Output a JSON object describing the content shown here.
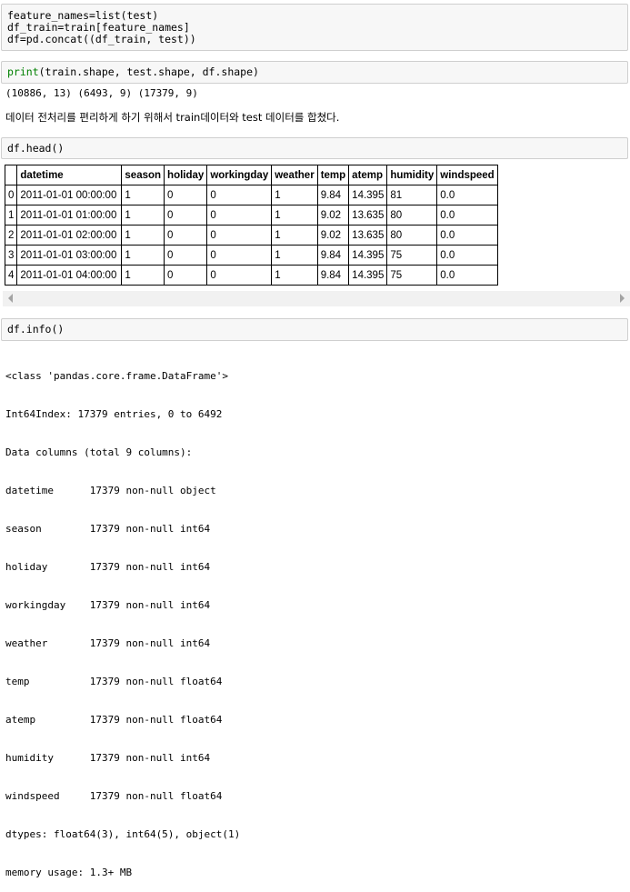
{
  "cells": {
    "c1": {
      "line1": "feature_names=list(test)",
      "line2": "df_train=train[feature_names]",
      "line3": "df=pd.concat((df_train, test))"
    },
    "c2": {
      "print_kw": "print",
      "rest": "(train.shape, test.shape, df.shape)",
      "output": "(10886, 13) (6493, 9) (17379, 9)"
    },
    "markdown": "데이터 전처리를 편리하게 하기 위해서 train데이터와 test 데이터를 합쳤다.",
    "c3": {
      "code": "df.head()"
    },
    "c4": {
      "code": "df.info()"
    }
  },
  "table": {
    "columns": [
      "",
      "datetime",
      "season",
      "holiday",
      "workingday",
      "weather",
      "temp",
      "atemp",
      "humidity",
      "windspeed"
    ],
    "rows": [
      [
        "0",
        "2011-01-01 00:00:00",
        "1",
        "0",
        "0",
        "1",
        "9.84",
        "14.395",
        "81",
        "0.0"
      ],
      [
        "1",
        "2011-01-01 01:00:00",
        "1",
        "0",
        "0",
        "1",
        "9.02",
        "13.635",
        "80",
        "0.0"
      ],
      [
        "2",
        "2011-01-01 02:00:00",
        "1",
        "0",
        "0",
        "1",
        "9.02",
        "13.635",
        "80",
        "0.0"
      ],
      [
        "3",
        "2011-01-01 03:00:00",
        "1",
        "0",
        "0",
        "1",
        "9.84",
        "14.395",
        "75",
        "0.0"
      ],
      [
        "4",
        "2011-01-01 04:00:00",
        "1",
        "0",
        "0",
        "1",
        "9.84",
        "14.395",
        "75",
        "0.0"
      ]
    ]
  },
  "info_lines": [
    "<class 'pandas.core.frame.DataFrame'>",
    "Int64Index: 17379 entries, 0 to 6492",
    "Data columns (total 9 columns):",
    "datetime      17379 non-null object",
    "season        17379 non-null int64",
    "holiday       17379 non-null int64",
    "workingday    17379 non-null int64",
    "weather       17379 non-null int64",
    "temp          17379 non-null float64",
    "atemp         17379 non-null float64",
    "humidity      17379 non-null int64",
    "windspeed     17379 non-null float64",
    "dtypes: float64(3), int64(5), object(1)",
    "memory usage: 1.3+ MB"
  ],
  "colors": {
    "cell_bg": "#f7f7f7",
    "cell_border": "#cfcfcf",
    "keyword": "#008000"
  }
}
